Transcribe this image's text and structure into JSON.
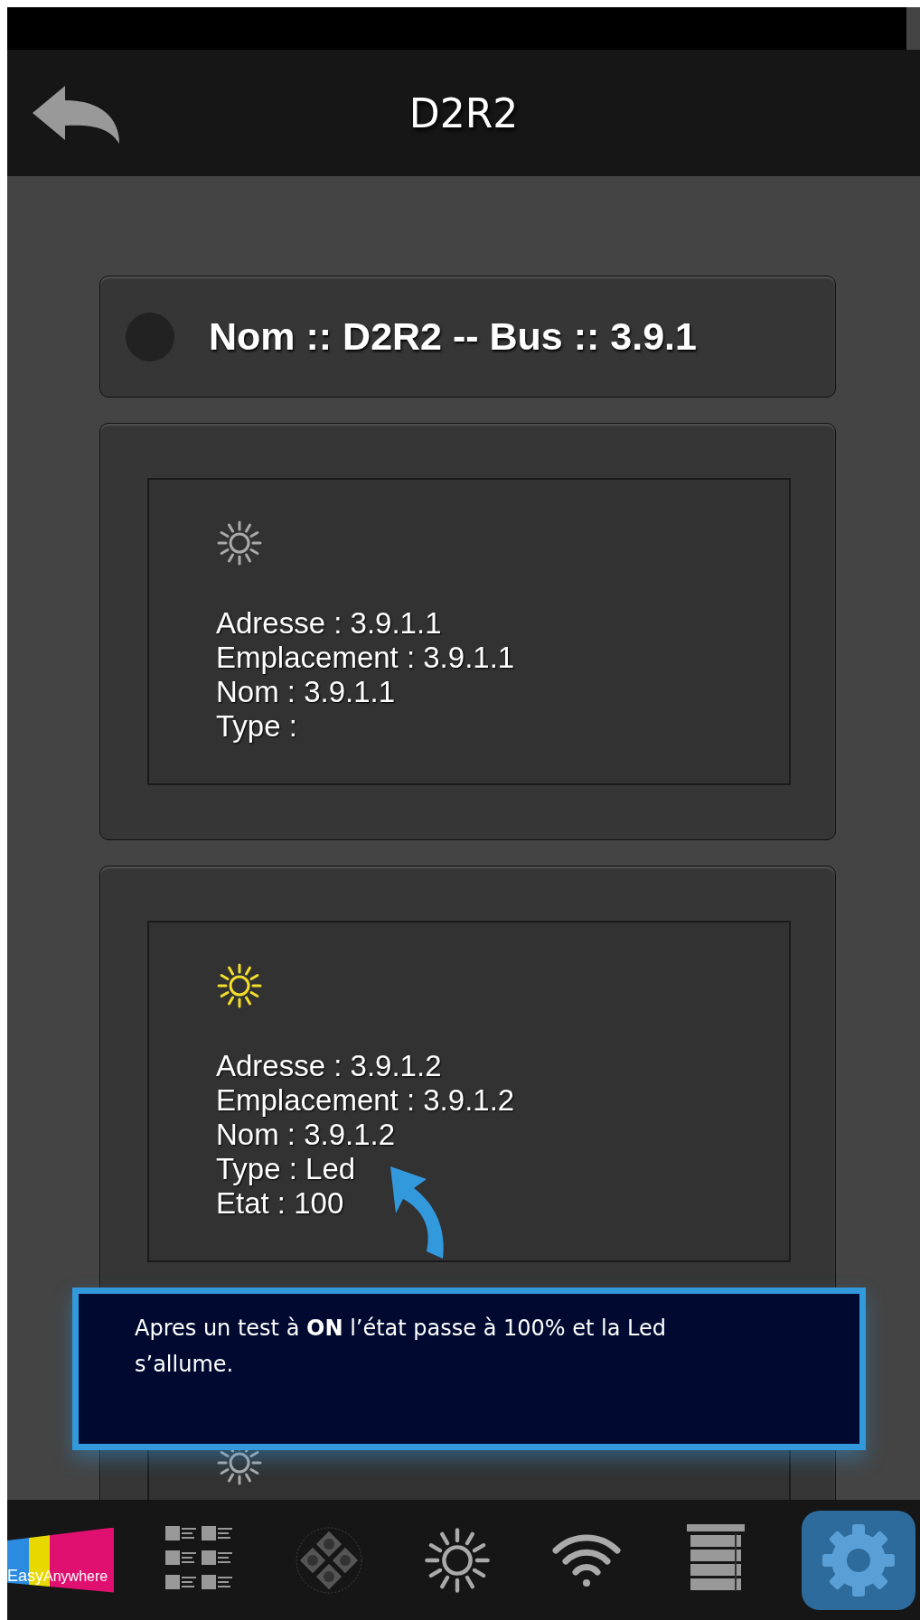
{
  "header": {
    "title": "D2R2"
  },
  "device": {
    "status_on": false,
    "title": "Nom :: D2R2 -- Bus :: 3.9.1"
  },
  "channels": [
    {
      "lit": false,
      "fields": [
        "Adresse : 3.9.1.1",
        "Emplacement : 3.9.1.1",
        "Nom : 3.9.1.1",
        "Type :"
      ]
    },
    {
      "lit": true,
      "fields": [
        "Adresse : 3.9.1.2",
        "Emplacement : 3.9.1.2",
        "Nom : 3.9.1.2",
        "Type : Led",
        "Etat : 100"
      ]
    },
    {
      "lit": false
    }
  ],
  "callout": {
    "text": "Apres un test à **ON** l’état passe à 100% et la Led s’allume."
  },
  "nav": {
    "logo": [
      "Easy",
      "Anywhere"
    ],
    "items": [
      {
        "kind": "scenes",
        "selected": false
      },
      {
        "kind": "remote",
        "selected": false
      },
      {
        "kind": "light",
        "selected": false
      },
      {
        "kind": "wifi",
        "selected": false
      },
      {
        "kind": "blinds",
        "selected": false
      },
      {
        "kind": "settings",
        "selected": true
      }
    ]
  }
}
